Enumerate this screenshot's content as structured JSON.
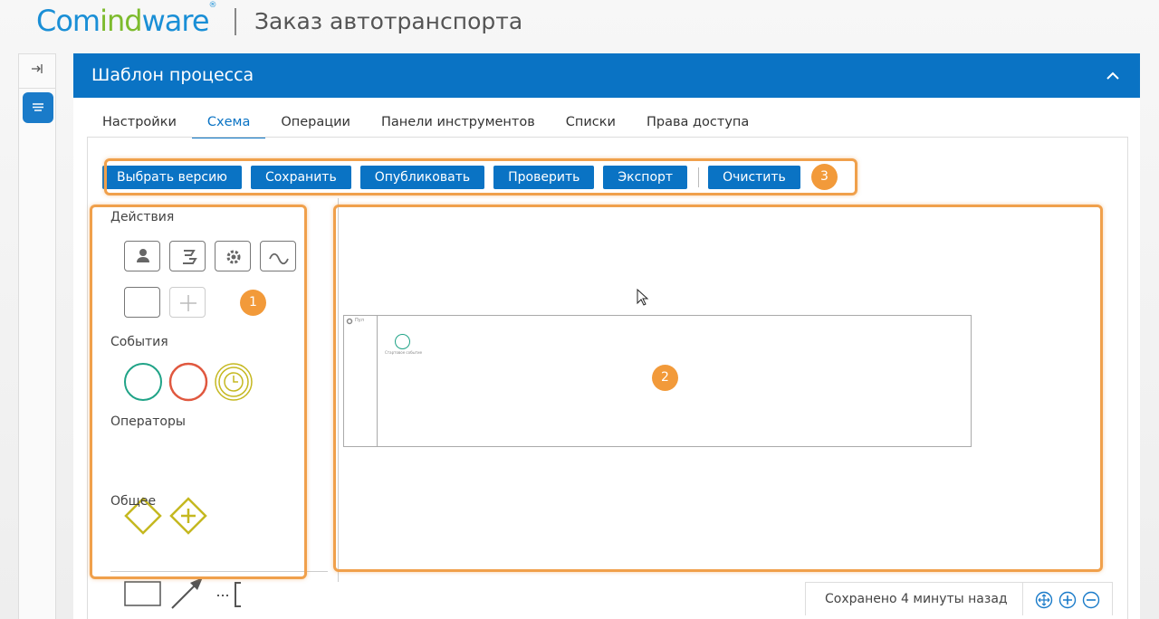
{
  "brand": {
    "part1": "Com",
    "part2": "ind",
    "part3": "ware",
    "reg": "®"
  },
  "app_title": "Заказ автотранспорта",
  "panel": {
    "title": "Шаблон процесса"
  },
  "tabs": [
    {
      "label": "Настройки",
      "active": false
    },
    {
      "label": "Схема",
      "active": true
    },
    {
      "label": "Операции",
      "active": false
    },
    {
      "label": "Панели инструментов",
      "active": false
    },
    {
      "label": "Списки",
      "active": false
    },
    {
      "label": "Права доступа",
      "active": false
    }
  ],
  "toolbar": {
    "select_version": "Выбрать версию",
    "save": "Сохранить",
    "publish": "Опубликовать",
    "check": "Проверить",
    "export": "Экспорт",
    "clear": "Очистить"
  },
  "palette": {
    "actions_title": "Действия",
    "events_title": "События",
    "operators_title": "Операторы",
    "general_title": "Общее"
  },
  "canvas": {
    "lane_name": "Пул",
    "start_event_label": "Стартовое событие"
  },
  "footer": {
    "status": "Сохранено 4 минуты назад"
  },
  "annotations": {
    "palette_badge": "1",
    "canvas_badge": "2",
    "toolbar_badge": "3"
  },
  "colors": {
    "primary": "#0a73c4",
    "accent_orange": "#f0a04b",
    "start_event": "#20a387",
    "end_event": "#e0583f",
    "timer_event": "#c5b820",
    "gateway": "#c5b820"
  }
}
